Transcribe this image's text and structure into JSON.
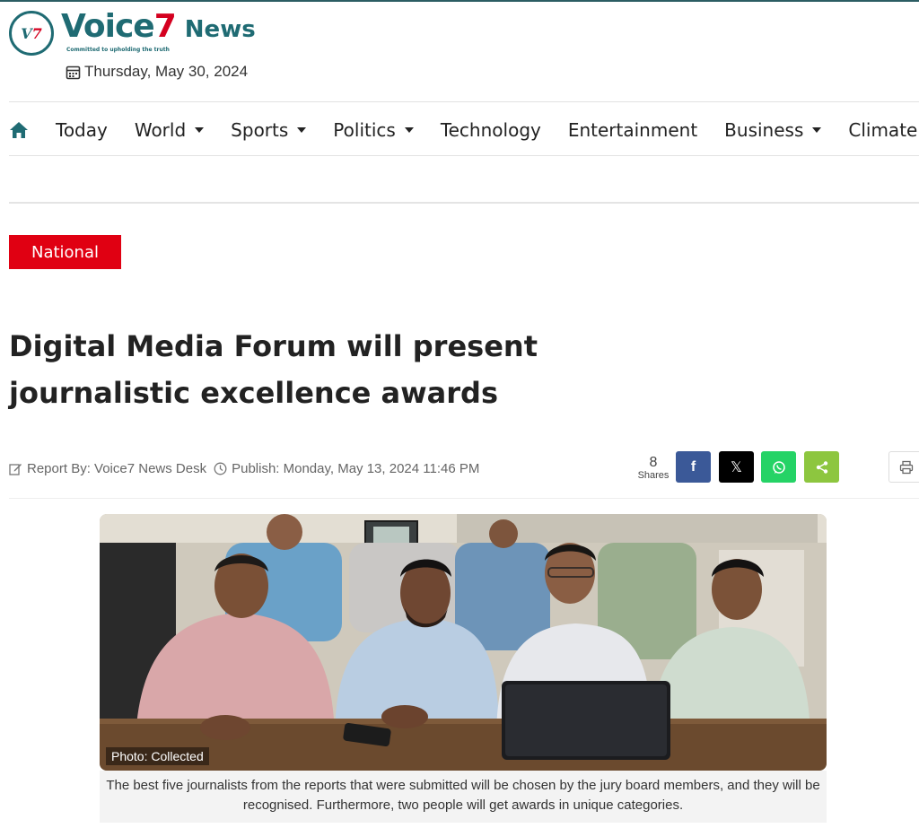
{
  "brand": {
    "name_main": "Voice",
    "name_num": "7",
    "name_suffix": "News",
    "tagline": "Committed to upholding the truth",
    "colors": {
      "primary": "#1f6b73",
      "accent": "#d4001f"
    }
  },
  "header": {
    "date": "Thursday, May 30, 2024",
    "date_icon": "calendar-icon"
  },
  "nav": {
    "home_icon": "home-icon",
    "items": [
      {
        "label": "Today",
        "has_dropdown": false
      },
      {
        "label": "World",
        "has_dropdown": true
      },
      {
        "label": "Sports",
        "has_dropdown": true
      },
      {
        "label": "Politics",
        "has_dropdown": true
      },
      {
        "label": "Technology",
        "has_dropdown": false
      },
      {
        "label": "Entertainment",
        "has_dropdown": false
      },
      {
        "label": "Business",
        "has_dropdown": true
      },
      {
        "label": "Climate",
        "has_dropdown": false
      }
    ]
  },
  "article": {
    "category": "National",
    "category_color": "#e00012",
    "headline": "Digital Media Forum will present journalistic excellence awards",
    "report_by": "Report By: Voice7 News Desk",
    "publish": "Publish: Monday, May 13, 2024 11:46 PM",
    "shares_count": "8",
    "shares_label": "Shares",
    "share_buttons": [
      {
        "name": "facebook",
        "glyph": "f",
        "color": "#3b5998"
      },
      {
        "name": "x",
        "glyph": "𝕏",
        "color": "#000000"
      },
      {
        "name": "whatsapp",
        "color": "#25d366"
      },
      {
        "name": "share",
        "color": "#8dc63f"
      }
    ],
    "photo_credit": "Photo: Collected",
    "caption": "The best five journalists from the reports that were submitted will be chosen by the jury board members, and they will be recognised. Furthermore, two people will get awards in unique categories."
  }
}
